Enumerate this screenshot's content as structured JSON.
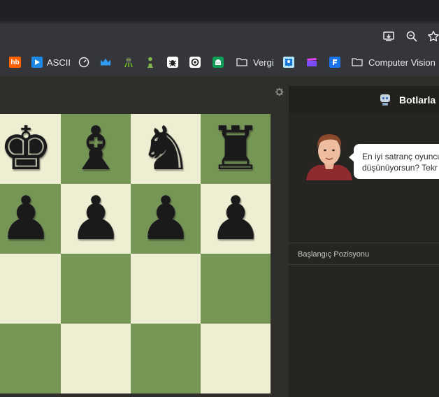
{
  "bookmarks": [
    {
      "icon": "hepsiburada-icon",
      "label": "",
      "x_hint": ""
    },
    {
      "icon": "ascii-play-icon",
      "label": "ASCII"
    },
    {
      "icon": "speedometer-icon",
      "label": ""
    },
    {
      "icon": "crown-icon",
      "label": ""
    },
    {
      "icon": "alien-icon",
      "label": ""
    },
    {
      "icon": "pawn-icon",
      "label": ""
    },
    {
      "icon": "bug-icon",
      "label": ""
    },
    {
      "icon": "openai-icon",
      "label": ""
    },
    {
      "icon": "android-icon",
      "label": ""
    },
    {
      "icon": "folder-icon",
      "label": "Vergi"
    },
    {
      "icon": "book-icon",
      "label": ""
    },
    {
      "icon": "clapper-icon",
      "label": ""
    },
    {
      "icon": "forms-icon",
      "label": ""
    },
    {
      "icon": "folder-icon",
      "label": "Computer Vision"
    }
  ],
  "hb_text": "hb",
  "ascii_label": "ASCII",
  "vergi_label": "Vergi",
  "cv_label": "Computer Vision",
  "panel": {
    "title": "Botlarla",
    "message_line1": "En iyi satranç oyuncu",
    "message_line2": "düşünüyorsun? Tekr",
    "opening": "Başlangıç Pozisyonu"
  },
  "board": {
    "rows": [
      [
        "♚",
        "♝",
        "♞",
        "♜"
      ],
      [
        "♟",
        "♟",
        "♟",
        "♟"
      ],
      [
        "",
        "",
        "",
        ""
      ],
      [
        "",
        "",
        "",
        ""
      ]
    ]
  },
  "colors": {
    "light_square": "#eeeed2",
    "dark_square": "#769656",
    "panel_bg": "#262522",
    "page_bg": "#302e2b"
  }
}
